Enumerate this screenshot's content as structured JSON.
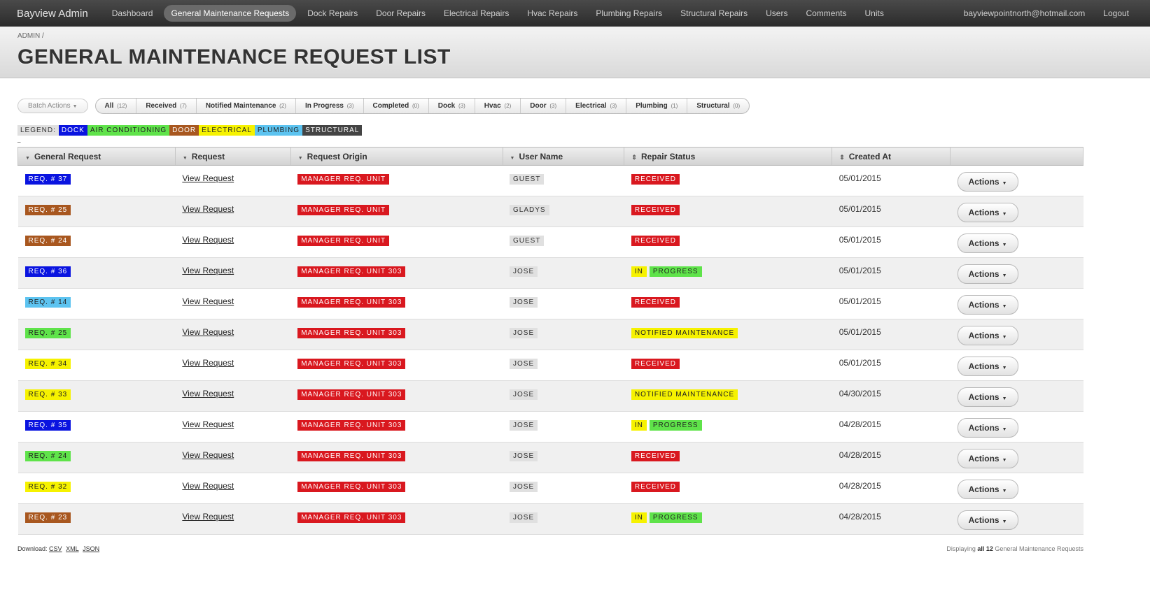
{
  "header": {
    "brand": "Bayview Admin",
    "nav": [
      "Dashboard",
      "General Maintenance Requests",
      "Dock Repairs",
      "Door Repairs",
      "Electrical Repairs",
      "Hvac Repairs",
      "Plumbing Repairs",
      "Structural Repairs",
      "Users",
      "Comments",
      "Units"
    ],
    "active_nav": "General Maintenance Requests",
    "user_email": "bayviewpointnorth@hotmail.com",
    "logout": "Logout"
  },
  "breadcrumb": "ADMIN",
  "breadcrumb_sep": "/",
  "page_title": "GENERAL MAINTENANCE REQUEST LIST",
  "batch_actions": "Batch Actions",
  "scopes": [
    {
      "label": "All",
      "count": "(12)"
    },
    {
      "label": "Received",
      "count": "(7)"
    },
    {
      "label": "Notified Maintenance",
      "count": "(2)"
    },
    {
      "label": "In Progress",
      "count": "(3)"
    },
    {
      "label": "Completed",
      "count": "(0)"
    },
    {
      "label": "Dock",
      "count": "(3)"
    },
    {
      "label": "Hvac",
      "count": "(2)"
    },
    {
      "label": "Door",
      "count": "(3)"
    },
    {
      "label": "Electrical",
      "count": "(3)"
    },
    {
      "label": "Plumbing",
      "count": "(1)"
    },
    {
      "label": "Structural",
      "count": "(0)"
    }
  ],
  "legend": [
    {
      "label": "LEGEND:",
      "bg": "#e0e0e0",
      "fg": "#333333"
    },
    {
      "label": "DOCK",
      "bg": "#0a14e0",
      "fg": "#ffffff"
    },
    {
      "label": "AIR CONDITIONING",
      "bg": "#5fe34a",
      "fg": "#222222"
    },
    {
      "label": "DOOR",
      "bg": "#a8571f",
      "fg": "#ffffff"
    },
    {
      "label": "ELECTRICAL",
      "bg": "#f6f200",
      "fg": "#222222"
    },
    {
      "label": "PLUMBING",
      "bg": "#5cc3f0",
      "fg": "#222222"
    },
    {
      "label": "STRUCTURAL",
      "bg": "#444444",
      "fg": "#ffffff"
    }
  ],
  "table": {
    "columns": [
      "General Request",
      "Request",
      "Request Origin",
      "User Name",
      "Repair Status",
      "Created At"
    ],
    "actions_label": "Actions",
    "rows": [
      {
        "req": "REQ. # 37",
        "cat": "dock",
        "link": "View Request",
        "origin": "MANAGER REQ. UNIT",
        "user": "GUEST",
        "status": [
          {
            "t": "RECEIVED",
            "k": "red"
          }
        ],
        "date": "05/01/2015"
      },
      {
        "req": "REQ. # 25",
        "cat": "door",
        "link": "View Request",
        "origin": "MANAGER REQ. UNIT",
        "user": "GLADYS",
        "status": [
          {
            "t": "RECEIVED",
            "k": "red"
          }
        ],
        "date": "05/01/2015"
      },
      {
        "req": "REQ. # 24",
        "cat": "door",
        "link": "View Request",
        "origin": "MANAGER REQ. UNIT",
        "user": "GUEST",
        "status": [
          {
            "t": "RECEIVED",
            "k": "red"
          }
        ],
        "date": "05/01/2015"
      },
      {
        "req": "REQ. # 36",
        "cat": "dock",
        "link": "View Request",
        "origin": "MANAGER REQ. UNIT 303",
        "user": "JOSE",
        "status": [
          {
            "t": "IN",
            "k": "yellow"
          },
          {
            "t": "PROGRESS",
            "k": "green"
          }
        ],
        "date": "05/01/2015"
      },
      {
        "req": "REQ. # 14",
        "cat": "plumbing",
        "link": "View Request",
        "origin": "MANAGER REQ. UNIT 303",
        "user": "JOSE",
        "status": [
          {
            "t": "RECEIVED",
            "k": "red"
          }
        ],
        "date": "05/01/2015"
      },
      {
        "req": "REQ. # 25",
        "cat": "ac",
        "link": "View Request",
        "origin": "MANAGER REQ. UNIT 303",
        "user": "JOSE",
        "status": [
          {
            "t": "NOTIFIED MAINTENANCE",
            "k": "yellow"
          }
        ],
        "date": "05/01/2015"
      },
      {
        "req": "REQ. # 34",
        "cat": "electrical",
        "link": "View Request",
        "origin": "MANAGER REQ. UNIT 303",
        "user": "JOSE",
        "status": [
          {
            "t": "RECEIVED",
            "k": "red"
          }
        ],
        "date": "05/01/2015"
      },
      {
        "req": "REQ. # 33",
        "cat": "electrical",
        "link": "View Request",
        "origin": "MANAGER REQ. UNIT 303",
        "user": "JOSE",
        "status": [
          {
            "t": "NOTIFIED MAINTENANCE",
            "k": "yellow"
          }
        ],
        "date": "04/30/2015"
      },
      {
        "req": "REQ. # 35",
        "cat": "dock",
        "link": "View Request",
        "origin": "MANAGER REQ. UNIT 303",
        "user": "JOSE",
        "status": [
          {
            "t": "IN",
            "k": "yellow"
          },
          {
            "t": "PROGRESS",
            "k": "green"
          }
        ],
        "date": "04/28/2015"
      },
      {
        "req": "REQ. # 24",
        "cat": "ac",
        "link": "View Request",
        "origin": "MANAGER REQ. UNIT 303",
        "user": "JOSE",
        "status": [
          {
            "t": "RECEIVED",
            "k": "red"
          }
        ],
        "date": "04/28/2015"
      },
      {
        "req": "REQ. # 32",
        "cat": "electrical",
        "link": "View Request",
        "origin": "MANAGER REQ. UNIT 303",
        "user": "JOSE",
        "status": [
          {
            "t": "RECEIVED",
            "k": "red"
          }
        ],
        "date": "04/28/2015"
      },
      {
        "req": "REQ. # 23",
        "cat": "door",
        "link": "View Request",
        "origin": "MANAGER REQ. UNIT 303",
        "user": "JOSE",
        "status": [
          {
            "t": "IN",
            "k": "yellow"
          },
          {
            "t": "PROGRESS",
            "k": "green"
          }
        ],
        "date": "04/28/2015"
      }
    ]
  },
  "category_colors": {
    "dock": {
      "bg": "#0a14e0",
      "fg": "#ffffff"
    },
    "door": {
      "bg": "#a8571f",
      "fg": "#ffffff"
    },
    "ac": {
      "bg": "#5fe34a",
      "fg": "#222222"
    },
    "electrical": {
      "bg": "#f6f200",
      "fg": "#222222"
    },
    "plumbing": {
      "bg": "#5cc3f0",
      "fg": "#222222"
    }
  },
  "status_colors": {
    "red": {
      "bg": "#d9181f",
      "fg": "#ffffff"
    },
    "yellow": {
      "bg": "#f6f200",
      "fg": "#222222"
    },
    "green": {
      "bg": "#5fe34a",
      "fg": "#222222"
    }
  },
  "footer": {
    "download_label": "Download:",
    "formats": [
      "CSV",
      "XML",
      "JSON"
    ],
    "displaying": "Displaying",
    "all": "all 12",
    "resource": "General Maintenance Requests"
  }
}
